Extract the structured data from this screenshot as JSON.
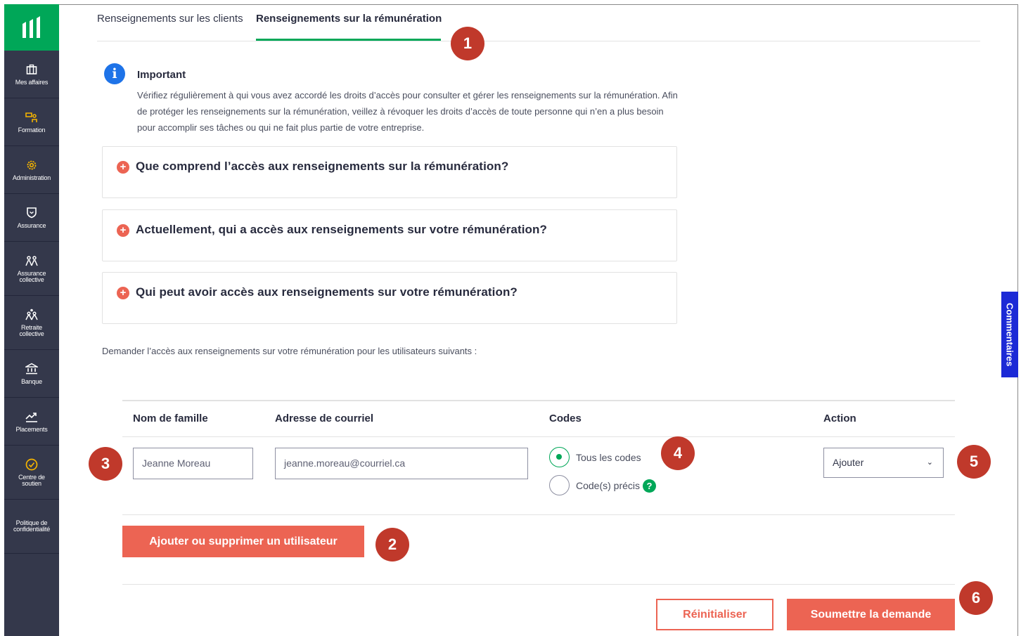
{
  "sidebar": {
    "logo": "manulife-logo-icon",
    "items": [
      {
        "label": "Mes affaires",
        "icon": "briefcase-icon"
      },
      {
        "label": "Formation",
        "icon": "training-icon"
      },
      {
        "label": "Administration",
        "icon": "gear-icon"
      },
      {
        "label": "Assurance",
        "icon": "shield-icon"
      },
      {
        "label": "Assurance collective",
        "icon": "group-icon"
      },
      {
        "label": "Retraite collective",
        "icon": "retirement-icon"
      },
      {
        "label": "Banque",
        "icon": "bank-icon"
      },
      {
        "label": "Placements",
        "icon": "chart-up-icon"
      },
      {
        "label": "Centre de soutien",
        "icon": "check-circle-icon"
      },
      {
        "label": "Politique de confidentialité",
        "icon": ""
      }
    ]
  },
  "tabs": {
    "clients": "Renseignements sur les clients",
    "remuneration": "Renseignements sur la rémunération"
  },
  "notice": {
    "title": "Important",
    "text": "Vérifiez régulièrement à qui vous avez accordé les droits d’accès pour consulter et gérer les renseignements sur la rémunération. Afin de protéger les renseignements sur la rémunération, veillez à révoquer les droits d’accès de toute personne qui n’en a plus besoin pour accomplir ses tâches ou qui ne fait plus partie de votre entreprise."
  },
  "accordions": [
    "Que comprend l’accès aux renseignements sur la rémunération?",
    "Actuellement, qui a accès aux renseignements sur votre rémunération?",
    "Qui peut avoir accès aux renseignements sur votre rémunération?"
  ],
  "request_text": "Demander l’accès aux renseignements sur votre rémunération pour les utilisateurs suivants :",
  "table": {
    "headers": [
      "Nom de famille",
      "Adresse de courriel",
      "Codes",
      "Action"
    ],
    "row": {
      "name": "Jeanne Moreau",
      "email": "jeanne.moreau@courriel.ca",
      "codes_options": [
        "Tous les codes",
        "Code(s) précis"
      ],
      "codes_selected": "Tous les codes",
      "action": "Ajouter"
    }
  },
  "buttons": {
    "add_remove": "Ajouter ou supprimer un utilisateur",
    "reset": "Réinitialiser",
    "submit": "Soumettre la demande"
  },
  "feedback": "Commentaires",
  "badges": [
    "1",
    "2",
    "3",
    "4",
    "5",
    "6"
  ],
  "colors": {
    "brand_green": "#00a758",
    "coral": "#ec6453",
    "sidebar": "#34384b",
    "badge": "#c0392b",
    "info_blue": "#1e73e8",
    "feedback_blue": "#1c2ad6"
  }
}
